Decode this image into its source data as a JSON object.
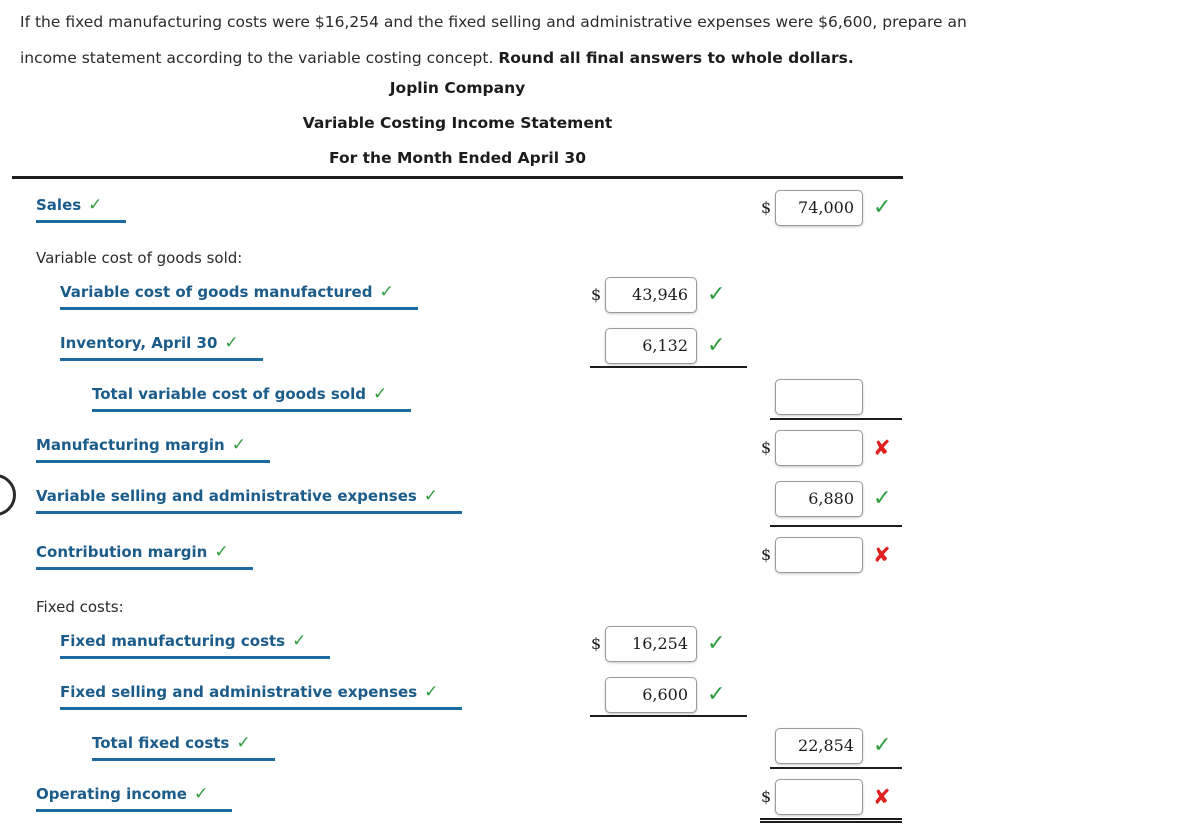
{
  "prompt": {
    "line1": "If the fixed manufacturing costs were $16,254 and the fixed selling and administrative expenses were $6,600, prepare an",
    "line2_pre": "income statement according to the variable costing concept. ",
    "line2_bold": "Round all final answers to whole dollars."
  },
  "statement": {
    "company": "Joplin Company",
    "title": "Variable Costing Income Statement",
    "period": "For the Month Ended April 30"
  },
  "symbols": {
    "check": "✓",
    "cross": "✘",
    "dollar": "$"
  },
  "colors": {
    "label_blue": "#1b5c8a",
    "underline_blue": "#1b6ca0",
    "check_green": "#2f9e3f",
    "cross_red": "#e02020"
  },
  "rows": [
    {
      "id": "sales",
      "label": "Sales",
      "kind": "account",
      "indent": 1,
      "col": 2,
      "value": "74,000",
      "dollar": true,
      "status": "correct"
    },
    {
      "id": "variable-cost-of-goods-sold-caption",
      "label": "Variable cost of goods sold:",
      "kind": "caption",
      "indent": 1
    },
    {
      "id": "variable-cost-of-goods-manufactured",
      "label": "Variable cost of goods manufactured",
      "kind": "account",
      "indent": 2,
      "col": 1,
      "value": "43,946",
      "dollar": true,
      "status": "correct"
    },
    {
      "id": "inventory-april-30",
      "label": "Inventory, April 30",
      "kind": "account",
      "indent": 2,
      "col": 1,
      "value": "6,132",
      "dollar": false,
      "status": "correct"
    },
    {
      "id": "total-variable-cost-of-goods-sold",
      "label": "Total variable cost of goods sold",
      "kind": "account",
      "indent": 3,
      "col": 2,
      "value": "",
      "dollar": false,
      "status": "none"
    },
    {
      "id": "manufacturing-margin",
      "label": "Manufacturing margin",
      "kind": "account",
      "indent": 1,
      "col": 2,
      "value": "",
      "dollar": true,
      "status": "incorrect"
    },
    {
      "id": "variable-selling-and-administrative-expenses",
      "label": "Variable selling and administrative expenses",
      "kind": "account",
      "indent": 1,
      "col": 2,
      "value": "6,880",
      "dollar": false,
      "status": "correct"
    },
    {
      "id": "contribution-margin",
      "label": "Contribution margin",
      "kind": "account",
      "indent": 1,
      "col": 2,
      "value": "",
      "dollar": true,
      "status": "incorrect"
    },
    {
      "id": "fixed-costs-caption",
      "label": "Fixed costs:",
      "kind": "caption",
      "indent": 1
    },
    {
      "id": "fixed-manufacturing-costs",
      "label": "Fixed manufacturing costs",
      "kind": "account",
      "indent": 2,
      "col": 1,
      "value": "16,254",
      "dollar": true,
      "status": "correct"
    },
    {
      "id": "fixed-selling-and-administrative-expenses",
      "label": "Fixed selling and administrative expenses",
      "kind": "account",
      "indent": 2,
      "col": 1,
      "value": "6,600",
      "dollar": false,
      "status": "correct"
    },
    {
      "id": "total-fixed-costs",
      "label": "Total fixed costs",
      "kind": "account",
      "indent": 3,
      "col": 2,
      "value": "22,854",
      "dollar": false,
      "status": "correct"
    },
    {
      "id": "operating-income",
      "label": "Operating income",
      "kind": "account",
      "indent": 1,
      "col": 2,
      "value": "",
      "dollar": true,
      "status": "incorrect"
    }
  ]
}
